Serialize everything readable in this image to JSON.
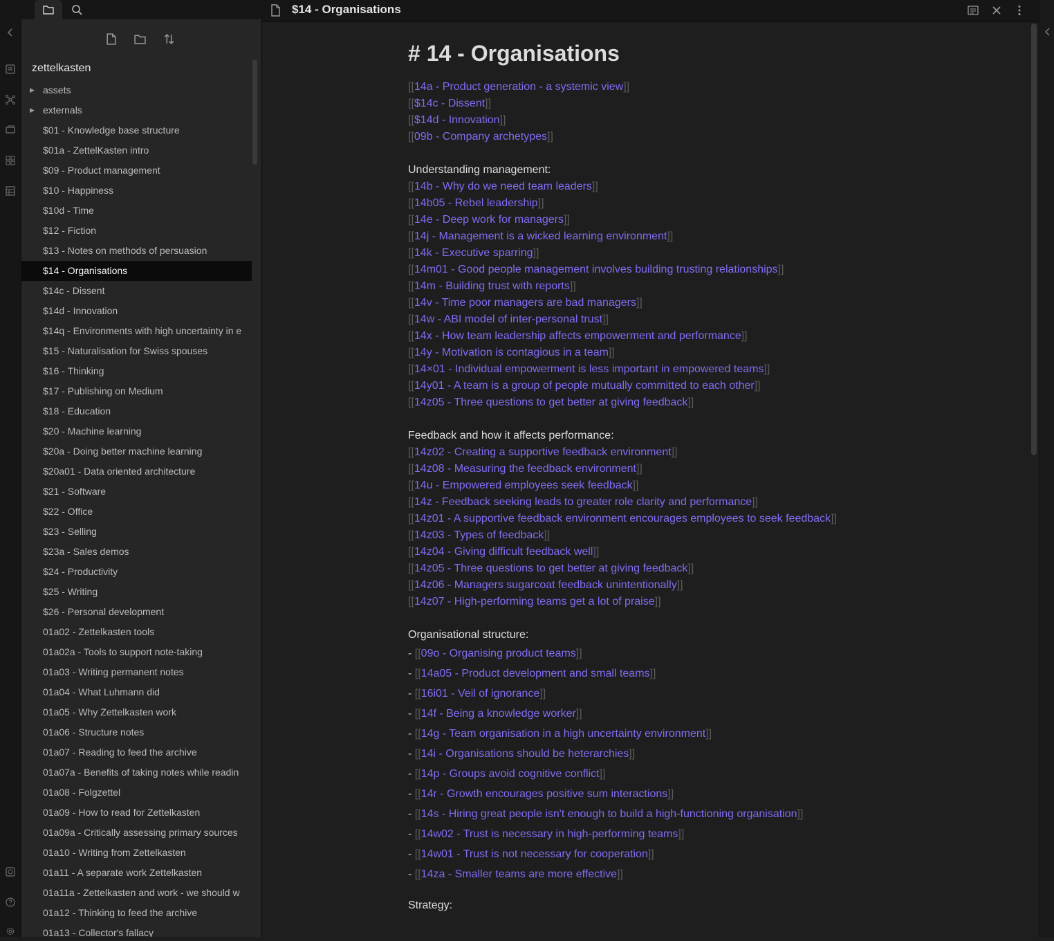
{
  "ribbon": {
    "icons": [
      "collapse-left-icon",
      "open-quick-switcher-icon",
      "graph-view-icon",
      "slides-icon",
      "kanban-icon",
      "table-icon",
      "vault-icon",
      "help-icon",
      "settings-icon"
    ]
  },
  "sidebar": {
    "tabs": [
      "file-explorer-icon",
      "search-icon"
    ],
    "actions": [
      "new-note-icon",
      "new-folder-icon",
      "sort-icon"
    ],
    "vault_name": "zettelkasten",
    "folders": [
      "assets",
      "externals"
    ],
    "files": [
      "$01 - Knowledge base structure",
      "$01a - ZettelKasten intro",
      "$09 - Product management",
      "$10 - Happiness",
      "$10d - Time",
      "$12 - Fiction",
      "$13 - Notes on methods of persuasion",
      "$14 - Organisations",
      "$14c - Dissent",
      "$14d - Innovation",
      "$14q - Environments with high uncertainty in e",
      "$15 - Naturalisation for Swiss spouses",
      "$16 - Thinking",
      "$17 - Publishing on Medium",
      "$18 - Education",
      "$20 - Machine learning",
      "$20a - Doing better machine learning",
      "$20a01 - Data oriented architecture",
      "$21 - Software",
      "$22 - Office",
      "$23 - Selling",
      "$23a - Sales demos",
      "$24 - Productivity",
      "$25 - Writing",
      "$26 - Personal development",
      "01a02 - Zettelkasten tools",
      "01a02a - Tools to support note-taking",
      "01a03 - Writing permanent notes",
      "01a04 - What Luhmann did",
      "01a05 - Why Zettelkasten work",
      "01a06 - Structure notes",
      "01a07 - Reading to feed the archive",
      "01a07a - Benefits of taking notes while readin",
      "01a08 - Folgzettel",
      "01a09 - How to read for Zettelkasten",
      "01a09a - Critically assessing primary sources",
      "01a10 - Writing from Zettelkasten",
      "01a11 - A separate work Zettelkasten",
      "01a11a - Zettelkasten and work - we should w",
      "01a12 - Thinking to feed the archive",
      "01a13 - Collector's fallacy"
    ],
    "active_file": "$14 - Organisations"
  },
  "editor": {
    "tab_title": "$14 - Organisations",
    "heading": "# 14 - Organisations",
    "top_links": [
      "14a - Product generation - a systemic view",
      "$14c - Dissent",
      "$14d - Innovation",
      "09b - Company archetypes"
    ],
    "section1_label": "Understanding management:",
    "section1_links": [
      "14b - Why do we need team leaders",
      "14b05 - Rebel leadership",
      "14e - Deep work for managers",
      "14j - Management is a wicked learning environment",
      "14k - Executive sparring",
      "14m01 - Good people management involves building trusting relationships",
      "14m - Building trust with reports",
      "14v - Time poor managers are bad managers",
      "14w - ABI model of inter-personal trust",
      "14x - How team leadership affects empowerment and performance",
      "14y - Motivation is contagious in a team",
      "14×01 - Individual empowerment is less important in empowered teams",
      "14y01 - A team is a group of people mutually committed to each other",
      "14z05 - Three questions to get better at giving feedback"
    ],
    "section2_label": "Feedback and how it affects performance:",
    "section2_links": [
      "14z02 - Creating a supportive feedback environment",
      "14z08 - Measuring the feedback environment",
      "14u - Empowered employees seek feedback",
      "14z - Feedback seeking leads to greater role clarity and performance",
      "14z01 - A supportive feedback environment encourages employees to seek feedback",
      "14z03 - Types of feedback",
      "14z04 - Giving difficult feedback well",
      "14z05 - Three questions to get better at giving feedback",
      "14z06 - Managers sugarcoat feedback unintentionally",
      "14z07 - High-performing teams get a lot of praise"
    ],
    "section3_label": "Organisational structure:",
    "section3_links": [
      "09o - Organising product teams",
      "14a05 - Product development and small teams",
      "16i01 - Veil of ignorance",
      "14f - Being a knowledge worker",
      "14g - Team organisation in a high uncertainty environment",
      "14i - Organisations should be heterarchies",
      "14p - Groups avoid cognitive conflict",
      "14r - Growth encourages positive sum interactions",
      "14s - Hiring great people isn't enough to build a high-functioning organisation",
      "14w02 - Trust is necessary in high-performing teams",
      "14w01 - Trust is not necessary for cooperation",
      "14za - Smaller teams are more effective"
    ],
    "section4_label": "Strategy:",
    "link_open": "[[",
    "link_close": "]]",
    "bullet": "- "
  },
  "colors": {
    "link": "#7f6df2",
    "bracket": "#5c5c5c",
    "text": "#dcddde",
    "background": "#1e1e1e"
  }
}
